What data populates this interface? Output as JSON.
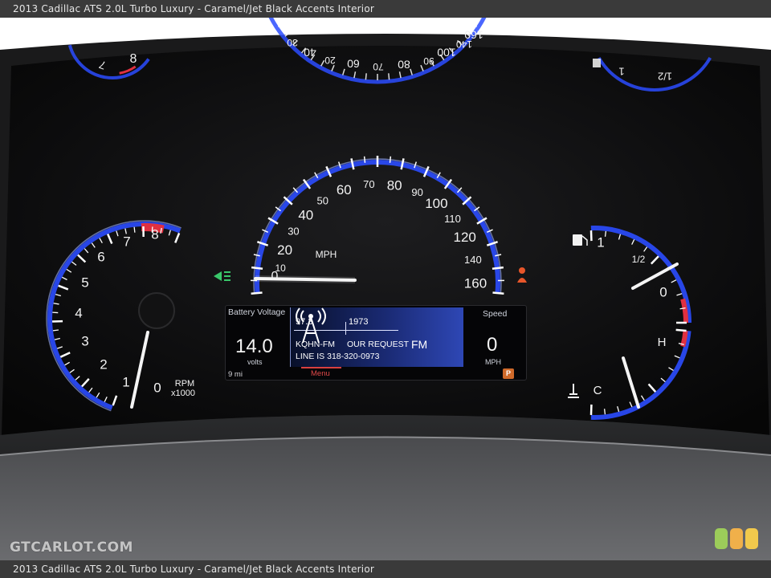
{
  "caption": {
    "top": "2013 Cadillac ATS 2.0L Turbo Luxury - Caramel/Jet Black Accents Interior",
    "bottom": "2013 Cadillac ATS 2.0L Turbo Luxury - Caramel/Jet Black Accents Interior"
  },
  "watermark": "GTCARLOT.COM",
  "badge_colors": [
    "#9ccc5a",
    "#f0b04a",
    "#f2c94c"
  ],
  "speedometer": {
    "labels": [
      "10",
      "20",
      "30",
      "40",
      "50",
      "60",
      "70",
      "80",
      "90",
      "100",
      "110",
      "120",
      "140",
      "160"
    ],
    "unit": "MPH",
    "reading_mph": 0
  },
  "tachometer": {
    "labels": [
      "0",
      "1",
      "2",
      "3",
      "4",
      "5",
      "6",
      "7",
      "8"
    ],
    "unit_line1": "RPM",
    "unit_line2": "x1000",
    "reading_rpm_x1000": 0
  },
  "fuel_temp": {
    "fuel_labels": [
      "1",
      "1/2",
      "0"
    ],
    "temp_labels": [
      "H",
      "C"
    ]
  },
  "mirror_speedometer": {
    "labels": [
      "30",
      "40",
      "20",
      "60",
      "70",
      "80",
      "90",
      "100",
      "140",
      "160"
    ]
  },
  "mirror_tach": {
    "labels": [
      "8",
      "7"
    ]
  },
  "mirror_fuel": {
    "labels": [
      "1",
      "1/2"
    ]
  },
  "display": {
    "battery_label": "Battery Voltage",
    "battery_value": "14.0",
    "battery_unit": "volts",
    "odometer": "9 mi",
    "freq_current": "97.3",
    "freq_next": "1973",
    "station": "KQHN-FM",
    "song": "OUR REQUEST",
    "phone_line": "LINE IS 318-320-0973",
    "band": "FM",
    "menu_label": "Menu",
    "speed_label": "Speed",
    "speed_value": "0",
    "speed_unit": "MPH",
    "parking_icon": "P"
  },
  "indicator_colors": {
    "gauge_blue": "#2b4cff",
    "redline": "#e03040",
    "headlight_green": "#39c76a",
    "warning_orange": "#e8562a"
  }
}
